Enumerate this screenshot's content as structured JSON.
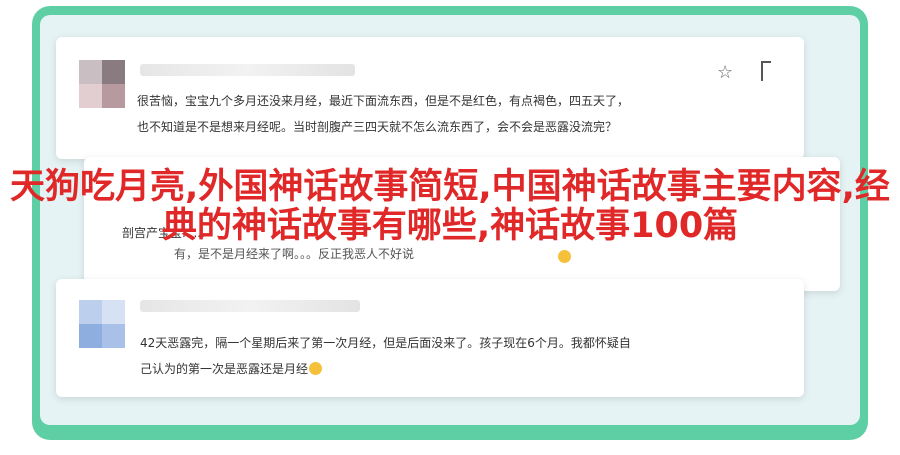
{
  "comments": [
    {
      "lines": [
        "很苦恼，宝宝九个多月还没来月经，最近下面流东西，但是不是红色，有点褐色，四五天了，",
        "也不知道是不是想来月经呢。当时剖腹产三四天就不怎么流东西了，会不会是恶露没流完？"
      ]
    },
    {
      "lines": [
        "剖宫产宝宝......",
        "有，是不是月经来了啊。。。反正我恶人不好说"
      ]
    },
    {
      "lines": [
        "42天恶露完，隔一个星期后来了第一次月经，但是后面没来了。孩子现在6个月。我都怀疑自",
        "己认为的第一次是恶露还是月经"
      ]
    }
  ],
  "icons": {
    "star": "star-icon",
    "flag": "flag-icon",
    "emoji": "emoji-icon"
  },
  "title": "天狗吃月亮,外国神话故事简短,中国神话故事主要内容,经典的神话故事有哪些,神话故事100篇",
  "colors": {
    "frame": "#5ecfa4",
    "title": "#e02828"
  }
}
